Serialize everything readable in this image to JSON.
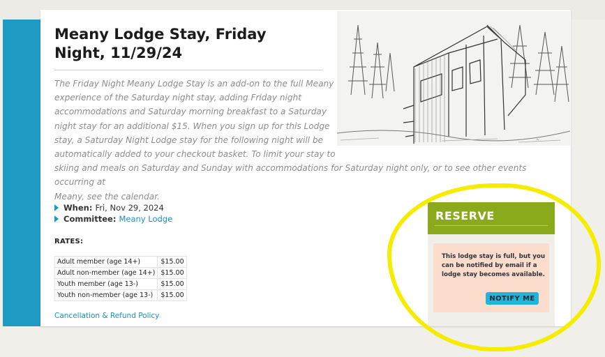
{
  "event": {
    "title": "Meany Lodge Stay, Friday Night, 11/29/24",
    "description_lines": [
      "The Friday Night Meany Lodge Stay is an add-on to the full Meany",
      "experience of the Saturday night stay, adding Friday night",
      "accommodations and Saturday morning breakfast to a Saturday",
      "night stay for an additional $15. When you sign up for this Lodge",
      "stay, a Saturday Night Lodge stay for the following night will be",
      "automatically added to your checkout basket. To limit your stay to",
      "skiing and meals on Saturday and Sunday with accommodations for Saturday night only, or to see other events occurring at",
      "Meany, see the calendar."
    ],
    "when_label": "When:",
    "when_value": "Fri, Nov 29, 2024",
    "committee_label": "Committee:",
    "committee_value": "Meany Lodge",
    "rates_title": "RATES:",
    "rates": [
      {
        "label": "Adult member (age 14+)",
        "price": "$15.00"
      },
      {
        "label": "Adult non-member (age 14+)",
        "price": "$15.00"
      },
      {
        "label": "Youth member (age 13-)",
        "price": "$15.00"
      },
      {
        "label": "Youth non-member (age 13-)",
        "price": "$15.00"
      }
    ],
    "policy_link": "Cancellation & Refund Policy"
  },
  "reserve": {
    "title": "RESERVE",
    "notice": "This lodge stay is full, but you can be notified by email if a lodge stay becomes available.",
    "button": "NOTIFY ME"
  },
  "image": {
    "icon": "lodge-sketch-illustration"
  },
  "colors": {
    "accent_blue": "#1f9ac2",
    "reserve_green": "#8aaa1c",
    "notice_bg": "#fcdccd",
    "button_blue": "#22b4d8",
    "highlight_yellow": "#f5ec00"
  }
}
